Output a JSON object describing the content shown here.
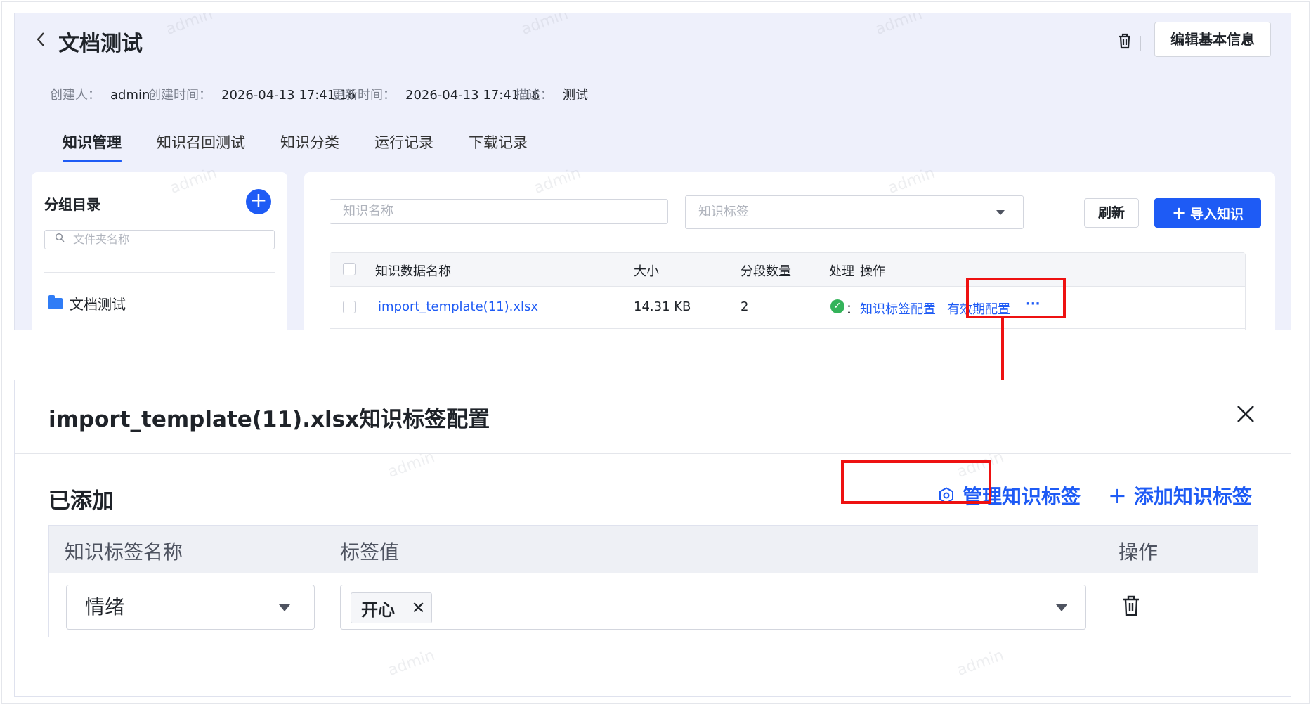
{
  "header": {
    "back_icon": "chevron-left-icon",
    "title": "文档测试",
    "edit_button": "编辑基本信息",
    "delete_icon": "trash-icon"
  },
  "meta": [
    {
      "key": "创建人：",
      "value": "admin"
    },
    {
      "key": "创建时间：",
      "value": "2026-04-13 17:41:16"
    },
    {
      "key": "更新时间：",
      "value": "2026-04-13 17:41:16"
    },
    {
      "key": "描述：",
      "value": "测试"
    }
  ],
  "tabs": [
    {
      "label": "知识管理",
      "active": true
    },
    {
      "label": "知识召回测试",
      "active": false
    },
    {
      "label": "知识分类",
      "active": false
    },
    {
      "label": "运行记录",
      "active": false
    },
    {
      "label": "下载记录",
      "active": false
    }
  ],
  "sidebar": {
    "title": "分组目录",
    "add_icon": "plus-circle-icon",
    "search_placeholder": "文件夹名称",
    "folders": [
      {
        "label": "文档测试",
        "icon": "folder-icon"
      }
    ]
  },
  "toolbar": {
    "name_placeholder": "知识名称",
    "tag_placeholder": "知识标签",
    "refresh_label": "刷新",
    "import_label": "导入知识"
  },
  "table": {
    "headers": {
      "name": "知识数据名称",
      "size": "大小",
      "segments": "分段数量",
      "status": "处理",
      "actions": "操作"
    },
    "rows": [
      {
        "name": "import_template(11).xlsx",
        "size": "14.31 KB",
        "segments": "2",
        "status_icon": "check-circle-icon",
        "status_trunc": "：",
        "action_tags": "知识标签配置",
        "action_expiry": "有效期配置",
        "action_more": "···"
      }
    ]
  },
  "dialog": {
    "title": "import_template(11).xlsx知识标签配置",
    "close_icon": "close-icon",
    "added_label": "已添加",
    "manage_label": "管理知识标签",
    "manage_icon": "gear-icon",
    "add_label": "添加知识标签",
    "add_icon": "plus-icon",
    "tag_table": {
      "headers": {
        "name": "知识标签名称",
        "value": "标签值",
        "action": "操作"
      },
      "rows": [
        {
          "name": "情绪",
          "values": [
            "开心"
          ],
          "remove_icon": "close-icon",
          "delete_icon": "trash-icon"
        }
      ]
    }
  },
  "watermark": "admin",
  "colors": {
    "accent": "#1e5bf5",
    "highlight": "#ee1111",
    "success": "#34b35a",
    "panel_bg": "#eef0fb"
  }
}
